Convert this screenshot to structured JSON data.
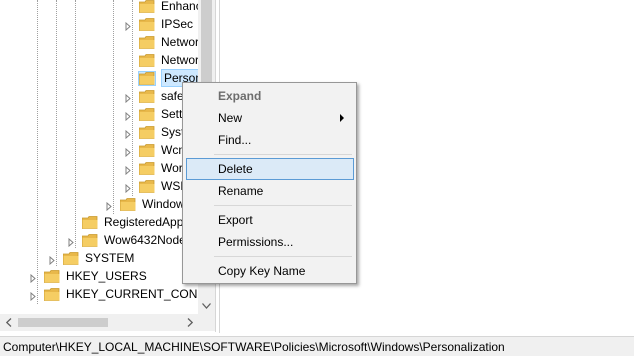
{
  "tree": {
    "items": [
      {
        "label": "Enhanc",
        "expander": "none"
      },
      {
        "label": "IPSec",
        "expander": "closed"
      },
      {
        "label": "Networ",
        "expander": "none"
      },
      {
        "label": "Networ",
        "expander": "none"
      },
      {
        "label": "Persona",
        "expander": "none",
        "selected": true
      },
      {
        "label": "safer",
        "expander": "closed"
      },
      {
        "label": "Setti",
        "expander": "closed"
      },
      {
        "label": "Syste",
        "expander": "closed"
      },
      {
        "label": "Wcm",
        "expander": "closed"
      },
      {
        "label": "Wor",
        "expander": "closed"
      },
      {
        "label": "WSD",
        "expander": "closed"
      },
      {
        "label": "Window",
        "expander": "closed"
      },
      {
        "label": "RegisteredAppl",
        "expander": "none"
      },
      {
        "label": "Wow6432Node",
        "expander": "closed"
      },
      {
        "label": "SYSTEM",
        "expander": "closed"
      },
      {
        "label": "HKEY_USERS",
        "expander": "closed"
      },
      {
        "label": "HKEY_CURRENT_CONFIG",
        "expander": "closed"
      }
    ]
  },
  "context_menu": {
    "expand": "Expand",
    "new": "New",
    "find": "Find...",
    "delete": "Delete",
    "rename": "Rename",
    "export": "Export",
    "permissions": "Permissions...",
    "copy_key_name": "Copy Key Name"
  },
  "status_bar": {
    "path": "Computer\\HKEY_LOCAL_MACHINE\\SOFTWARE\\Policies\\Microsoft\\Windows\\Personalization"
  },
  "colors": {
    "folder": "#e8b84a",
    "selection": "#cde8ff",
    "menu_highlight": "#dbeaf7"
  }
}
